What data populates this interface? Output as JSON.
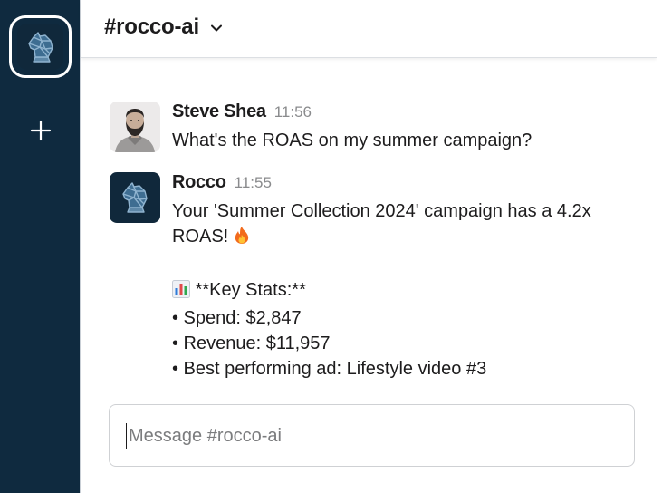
{
  "colors": {
    "rail_bg": "#0f2a3f",
    "text_primary": "#1d1c1d",
    "text_muted": "#8a8b8d",
    "flame": "#f26b1d"
  },
  "sidebar": {
    "workspace_icon": "knight-logo-icon",
    "add_icon": "plus-icon"
  },
  "header": {
    "channel_name": "#rocco-ai",
    "dropdown_icon": "chevron-down-icon"
  },
  "messages": [
    {
      "sender": "Steve Shea",
      "time": "11:56",
      "avatar_icon": "user-photo-avatar",
      "lines": [
        "What's the ROAS on my summer campaign?"
      ]
    },
    {
      "sender": "Rocco",
      "time": "11:55",
      "avatar_icon": "knight-logo-icon",
      "lines": [
        "Your 'Summer Collection 2024' campaign has a 4.2x",
        "ROAS!",
        "",
        "**Key Stats:**",
        "• Spend: $2,847",
        "• Revenue: $11,957",
        "• Best performing ad: Lifestyle video #3"
      ],
      "emojis": {
        "fire": "fire-icon",
        "chart": "bar-chart-icon"
      }
    }
  ],
  "composer": {
    "placeholder": "Message #rocco-ai",
    "value": ""
  }
}
